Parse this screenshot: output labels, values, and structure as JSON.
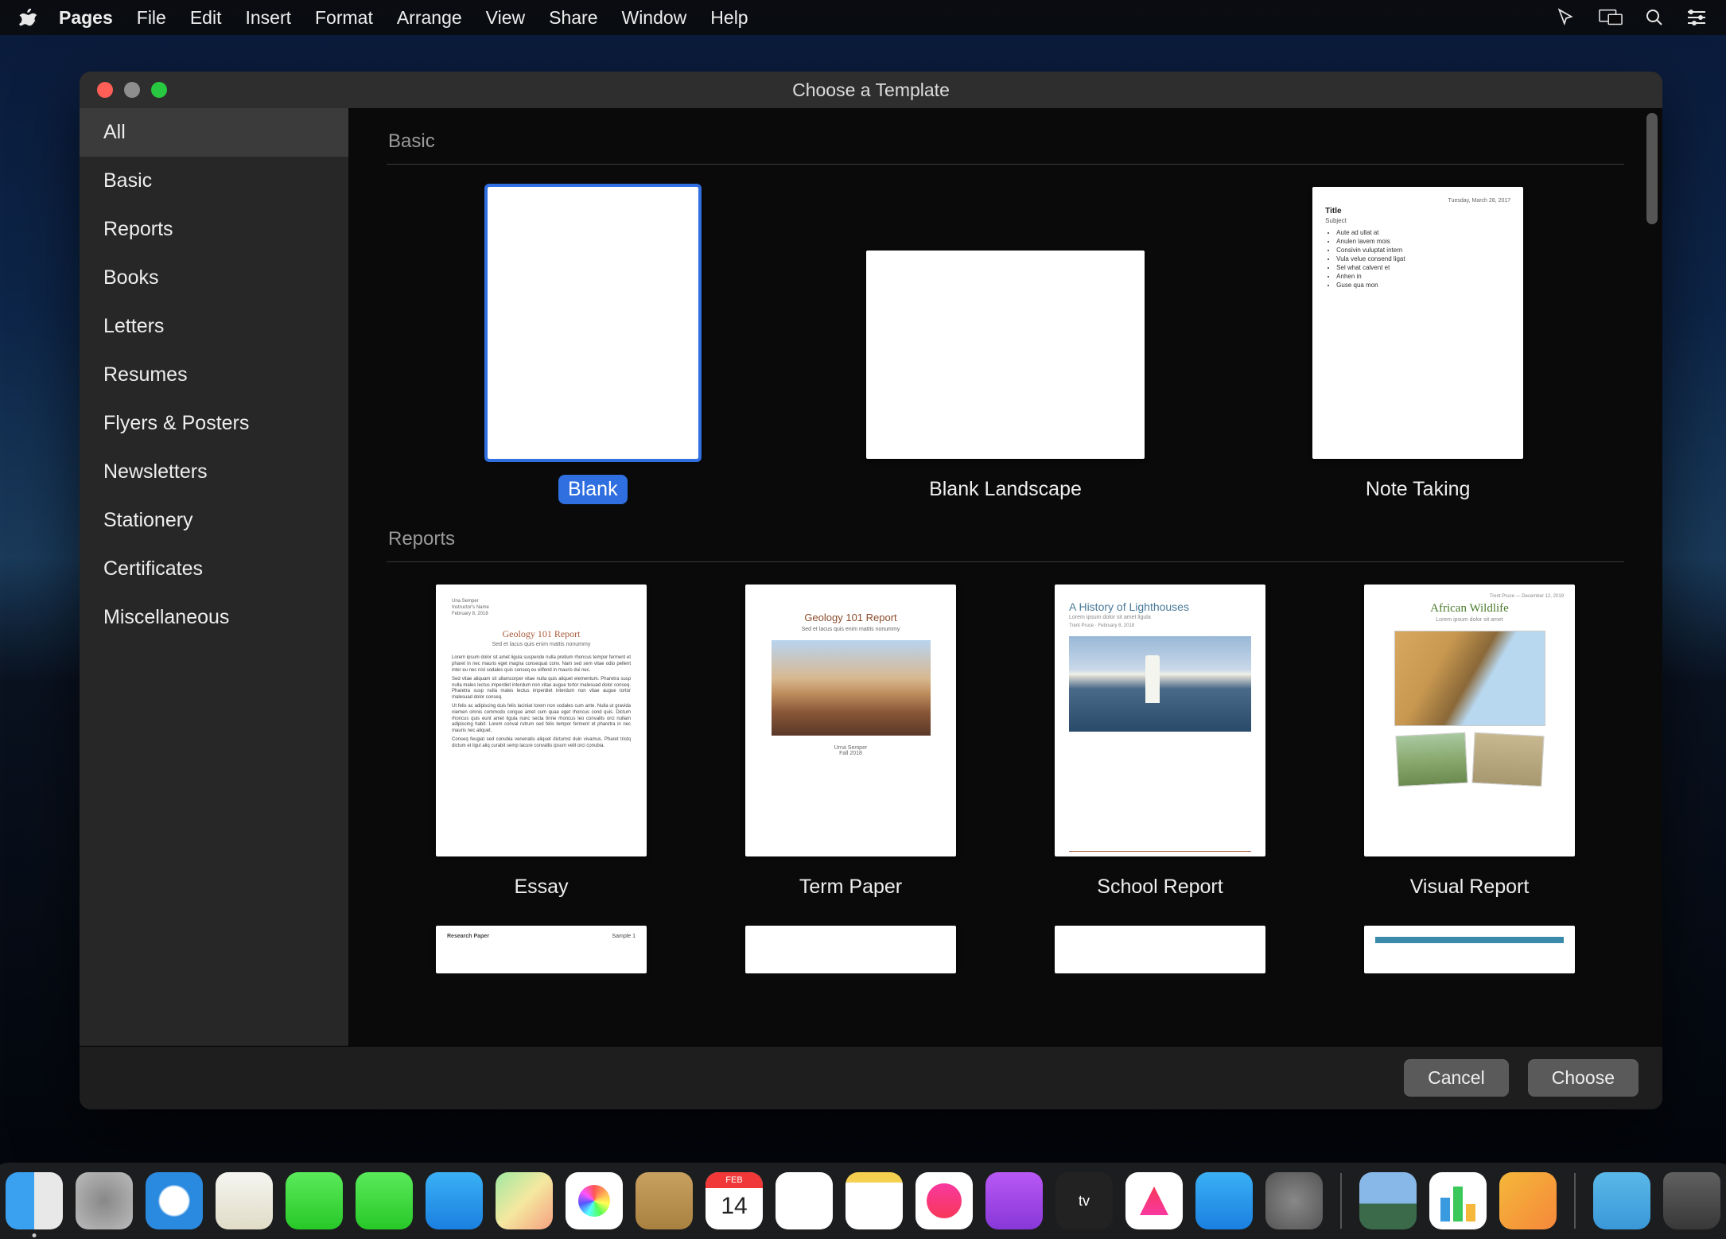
{
  "menubar": {
    "app": "Pages",
    "items": [
      "File",
      "Edit",
      "Insert",
      "Format",
      "Arrange",
      "View",
      "Share",
      "Window",
      "Help"
    ]
  },
  "window": {
    "title": "Choose a Template",
    "sidebar": {
      "items": [
        "All",
        "Basic",
        "Reports",
        "Books",
        "Letters",
        "Resumes",
        "Flyers & Posters",
        "Newsletters",
        "Stationery",
        "Certificates",
        "Miscellaneous"
      ],
      "selected": "All"
    },
    "sections": [
      {
        "title": "Basic",
        "templates": [
          {
            "label": "Blank",
            "kind": "blank",
            "selected": true
          },
          {
            "label": "Blank Landscape",
            "kind": "blank-landscape"
          },
          {
            "label": "Note Taking",
            "kind": "note-taking"
          }
        ]
      },
      {
        "title": "Reports",
        "templates": [
          {
            "label": "Essay",
            "kind": "essay"
          },
          {
            "label": "Term Paper",
            "kind": "term-paper"
          },
          {
            "label": "School Report",
            "kind": "school-report"
          },
          {
            "label": "Visual Report",
            "kind": "visual-report"
          }
        ]
      }
    ],
    "buttons": {
      "cancel": "Cancel",
      "choose": "Choose"
    }
  },
  "previews": {
    "note": {
      "date": "Tuesday, March 28, 2017",
      "title": "Title",
      "subject": "Subject",
      "bullets": [
        "Aute ad ullat at",
        "Anulen lavem mois",
        "Consivin vuluptat intern",
        "Vula velue consend ligat",
        "Sel what calvent et",
        "Anhen in",
        "Guse qua mon"
      ]
    },
    "essay": {
      "meta": [
        "Una Semper",
        "Instructor's Name",
        "February 8, 2018"
      ],
      "title": "Geology 101 Report",
      "subtitle": "Sed et lacus quis enim mattis nonummy"
    },
    "term": {
      "title": "Geology 101 Report",
      "subtitle": "Sed et lacus quis enim mattis nonummy",
      "author": "Urna Semper",
      "term": "Fall 2018"
    },
    "school": {
      "title": "A History of Lighthouses",
      "subtitle": "Lorem ipsum dolor sit amet ligula",
      "meta": "Trent Pruce · February 8, 2018"
    },
    "visual": {
      "meta": "Trent Pruce — December 12, 2019",
      "title": "African Wildlife",
      "subtitle": "Lorem ipsum dolor sit amet"
    },
    "partial": {
      "research": "Research Paper",
      "sample": "Sample 1"
    }
  },
  "dock": {
    "apps": [
      "finder",
      "launchpad",
      "safari",
      "mail",
      "messages",
      "facetime",
      "contacts",
      "maps",
      "photos",
      "addressbook",
      "calendar",
      "reminders",
      "notes",
      "music",
      "podcasts",
      "tv",
      "news",
      "appstore",
      "settings"
    ],
    "right": [
      "gallery",
      "charts",
      "numbers"
    ],
    "folder": "downloads",
    "trash": "trash",
    "running": "finder"
  }
}
